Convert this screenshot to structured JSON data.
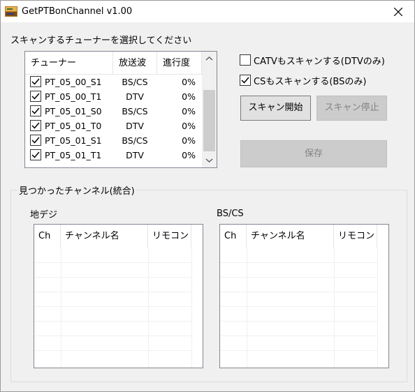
{
  "window": {
    "title": "GetPTBonChannel v1.00",
    "close_icon": "close-icon"
  },
  "tuner_section": {
    "label": "スキャンするチューナーを選択してください",
    "columns": [
      "チューナー",
      "放送波",
      "進行度"
    ],
    "rows": [
      {
        "checked": true,
        "name": "PT_05_00_S1",
        "band": "BS/CS",
        "progress": "0%"
      },
      {
        "checked": true,
        "name": "PT_05_00_T1",
        "band": "DTV",
        "progress": "0%"
      },
      {
        "checked": true,
        "name": "PT_05_01_S0",
        "band": "BS/CS",
        "progress": "0%"
      },
      {
        "checked": true,
        "name": "PT_05_01_T0",
        "band": "DTV",
        "progress": "0%"
      },
      {
        "checked": true,
        "name": "PT_05_01_S1",
        "band": "BS/CS",
        "progress": "0%"
      },
      {
        "checked": true,
        "name": "PT_05_01_T1",
        "band": "DTV",
        "progress": "0%"
      }
    ]
  },
  "options": {
    "catv": {
      "label": "CATVもスキャンする(DTVのみ)",
      "checked": false
    },
    "cs": {
      "label": "CSもスキャンする(BSのみ)",
      "checked": true
    }
  },
  "buttons": {
    "start": "スキャン開始",
    "stop": "スキャン停止",
    "save": "保存"
  },
  "found_channels": {
    "label": "見つかったチャンネル(統合)",
    "terrestrial": {
      "label": "地デジ",
      "columns": [
        "Ch",
        "チャンネル名",
        "リモコン"
      ]
    },
    "bscs": {
      "label": "BS/CS",
      "columns": [
        "Ch",
        "チャンネル名",
        "リモコン"
      ]
    }
  }
}
